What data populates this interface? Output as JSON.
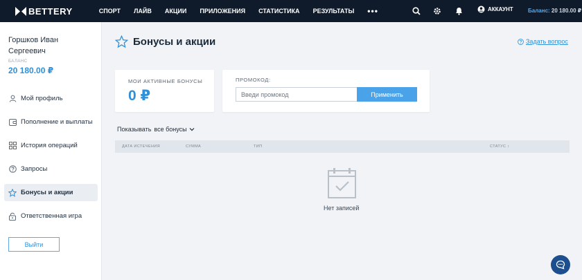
{
  "brand": {
    "name": "BETTERY"
  },
  "nav": {
    "items": [
      "СПОРТ",
      "ЛАЙВ",
      "АКЦИИ",
      "ПРИЛОЖЕНИЯ",
      "СТАТИСТИКА",
      "РЕЗУЛЬТАТЫ"
    ],
    "more": "•••"
  },
  "header": {
    "account_label": "АККАУНТ",
    "balance_label": "Баланс:",
    "balance_value": "20 180.00 ₽",
    "icons": [
      "search-icon",
      "gear-icon",
      "bell-icon",
      "user-icon"
    ]
  },
  "sidebar": {
    "user_name": "Горшков Иван Сергеевич",
    "balance_label": "БАЛАНС",
    "balance_value": "20 180.00 ₽",
    "items": [
      {
        "label": "Мой профиль",
        "icon": "user-icon"
      },
      {
        "label": "Пополнение и выплаты",
        "icon": "wallet-icon"
      },
      {
        "label": "История операций",
        "icon": "grid-icon"
      },
      {
        "label": "Запросы",
        "icon": "question-icon"
      },
      {
        "label": "Бонусы и акции",
        "icon": "star-icon",
        "active": true
      },
      {
        "label": "Ответственная игра",
        "icon": "lock-icon"
      }
    ],
    "logout_label": "Выйти"
  },
  "main": {
    "title": "Бонусы и акции",
    "ask_question": "Задать вопрос",
    "active_bonuses_label": "МОИ АКТИВНЫЕ БОНУСЫ",
    "active_bonuses_value": "0 ₽",
    "promo_label": "ПРОМОКОД:",
    "promo_placeholder": "Введи промокод",
    "promo_value": "",
    "apply_label": "Применить",
    "filter_label": "Показывать",
    "filter_value": "все бонусы",
    "table_columns": [
      "ДАТА ИСТЕЧЕНИЯ",
      "СУММА",
      "ТИП",
      "СТАТУС"
    ],
    "status_sort_icon": "↕",
    "empty_text": "Нет записей"
  },
  "colors": {
    "topbar": "#0f1b2b",
    "accent": "#2f8fd8",
    "button": "#4aa3e8",
    "chat": "#1d4f8f"
  }
}
